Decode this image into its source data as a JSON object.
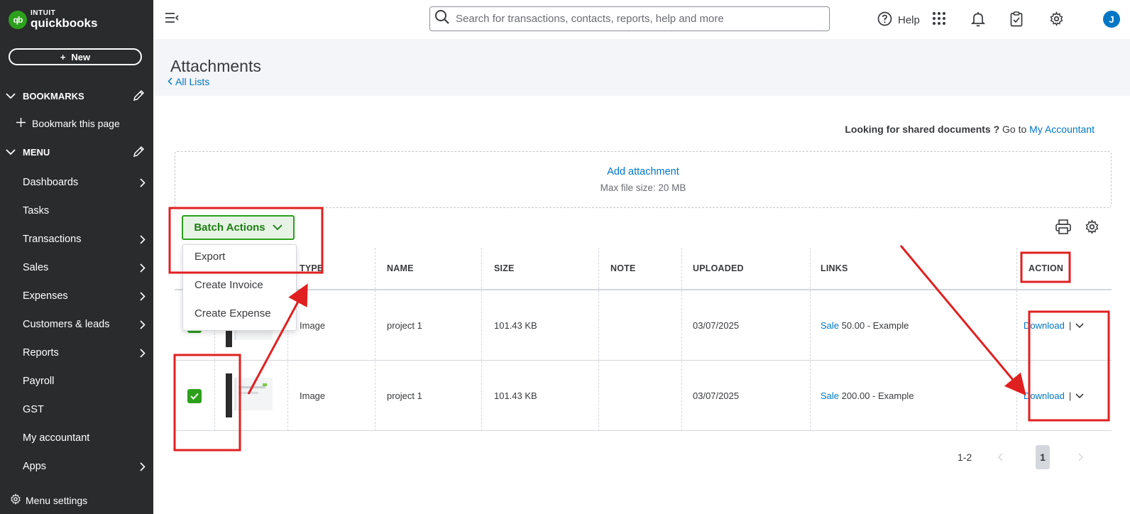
{
  "brand": {
    "logo_small": "INTUIT",
    "logo_big": "quickbooks",
    "logo_mark": "qb"
  },
  "sidebar": {
    "new_label": "New",
    "bookmarks_label": "BOOKMARKS",
    "bookmark_page_label": "Bookmark this page",
    "menu_label": "MENU",
    "items": [
      {
        "label": "Dashboards",
        "has_arrow": true
      },
      {
        "label": "Tasks",
        "has_arrow": false
      },
      {
        "label": "Transactions",
        "has_arrow": true
      },
      {
        "label": "Sales",
        "has_arrow": true
      },
      {
        "label": "Expenses",
        "has_arrow": true
      },
      {
        "label": "Customers & leads",
        "has_arrow": true
      },
      {
        "label": "Reports",
        "has_arrow": true
      },
      {
        "label": "Payroll",
        "has_arrow": false
      },
      {
        "label": "GST",
        "has_arrow": false
      },
      {
        "label": "My accountant",
        "has_arrow": false
      },
      {
        "label": "Apps",
        "has_arrow": true
      }
    ],
    "menu_settings_label": "Menu settings"
  },
  "topbar": {
    "search_placeholder": "Search for transactions, contacts, reports, help and more",
    "help_label": "Help",
    "avatar_initial": "J",
    "icons": [
      "menu-collapse-icon",
      "search-icon",
      "help-icon",
      "apps-grid-icon",
      "bell-icon",
      "clipboard-check-icon",
      "gear-icon"
    ]
  },
  "page": {
    "title": "Attachments",
    "back_link": "All Lists",
    "shared_prefix": "Looking for shared documents ?",
    "shared_goto": "Go to",
    "shared_link": "My Accountant",
    "add_attachment": "Add attachment",
    "max_file_size": "Max file size: 20 MB",
    "batch_actions_label": "Batch Actions"
  },
  "batch_menu": {
    "items": [
      "Export",
      "Create Invoice",
      "Create Expense"
    ]
  },
  "table": {
    "headers": {
      "type": "TYPE",
      "name": "NAME",
      "size": "SIZE",
      "note": "NOTE",
      "uploaded": "UPLOADED",
      "links": "LINKS",
      "action": "ACTION"
    },
    "rows": [
      {
        "checked": true,
        "type": "Image",
        "name": "project 1",
        "size": "101.43 KB",
        "note": "",
        "uploaded": "03/07/2025",
        "link_type": "Sale",
        "link_text": "50.00 - Example",
        "action": "Download",
        "action_sep": "|"
      },
      {
        "checked": true,
        "type": "Image",
        "name": "project 1",
        "size": "101.43 KB",
        "note": "",
        "uploaded": "03/07/2025",
        "link_type": "Sale",
        "link_text": "200.00 - Example",
        "action": "Download",
        "action_sep": "|"
      }
    ]
  },
  "pagination": {
    "range": "1-2",
    "current_page": "1"
  },
  "colors": {
    "sidebar_bg": "#2a2b2d",
    "brand_green": "#2ca01c",
    "link_blue": "#0077c5",
    "annotation_red": "#e02020"
  }
}
